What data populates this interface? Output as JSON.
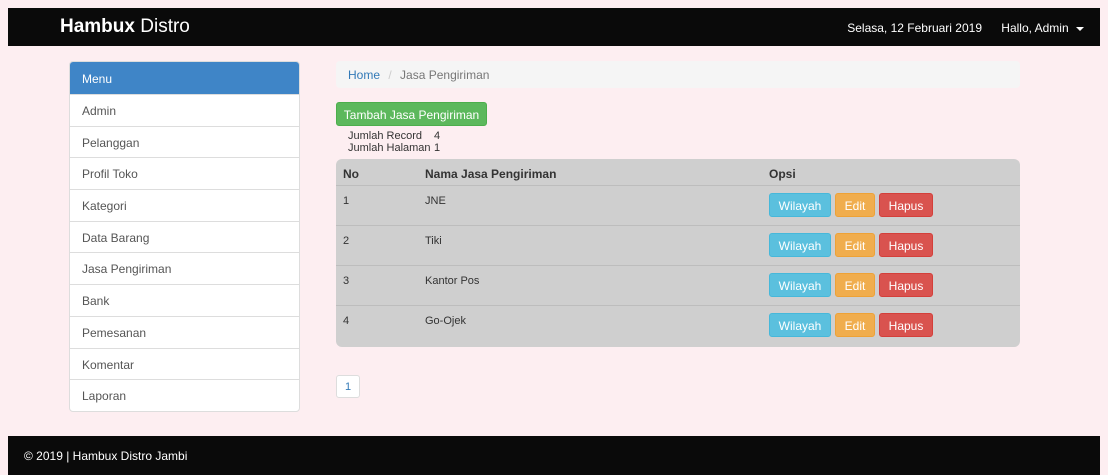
{
  "navbar": {
    "brand_bold": "Hambux",
    "brand_rest": "Distro",
    "date": "Selasa, 12 Februari 2019",
    "user": "Hallo, Admin"
  },
  "menu": {
    "title": "Menu",
    "items": [
      "Admin",
      "Pelanggan",
      "Profil Toko",
      "Kategori",
      "Data Barang",
      "Jasa Pengiriman",
      "Bank",
      "Pemesanan",
      "Komentar",
      "Laporan"
    ]
  },
  "breadcrumb": {
    "home": "Home",
    "separator": "/",
    "current": "Jasa Pengiriman"
  },
  "add_button": "Tambah Jasa Pengiriman",
  "stats": {
    "record_label": "Jumlah Record",
    "record_value": "4",
    "page_label": "Jumlah Halaman",
    "page_value": "1"
  },
  "table": {
    "headers": [
      "No",
      "Nama Jasa Pengiriman",
      "Opsi"
    ],
    "rows": [
      {
        "no": "1",
        "nama": "JNE"
      },
      {
        "no": "2",
        "nama": "Tiki"
      },
      {
        "no": "3",
        "nama": "Kantor Pos"
      },
      {
        "no": "4",
        "nama": "Go-Ojek"
      }
    ],
    "actions": {
      "wilayah": "Wilayah",
      "edit": "Edit",
      "hapus": "Hapus"
    }
  },
  "pagination": {
    "current": "1"
  },
  "footer": {
    "text": "© 2019 |   Hambux Distro Jambi"
  },
  "colors": {
    "menu_header": "#3f85c7",
    "add_button": "#5cb85c",
    "wilayah": "#5bc0de",
    "edit": "#f0ad4e",
    "hapus": "#d9534f",
    "navbar": "#0a0a0a",
    "page_background": "#fdeef1"
  }
}
